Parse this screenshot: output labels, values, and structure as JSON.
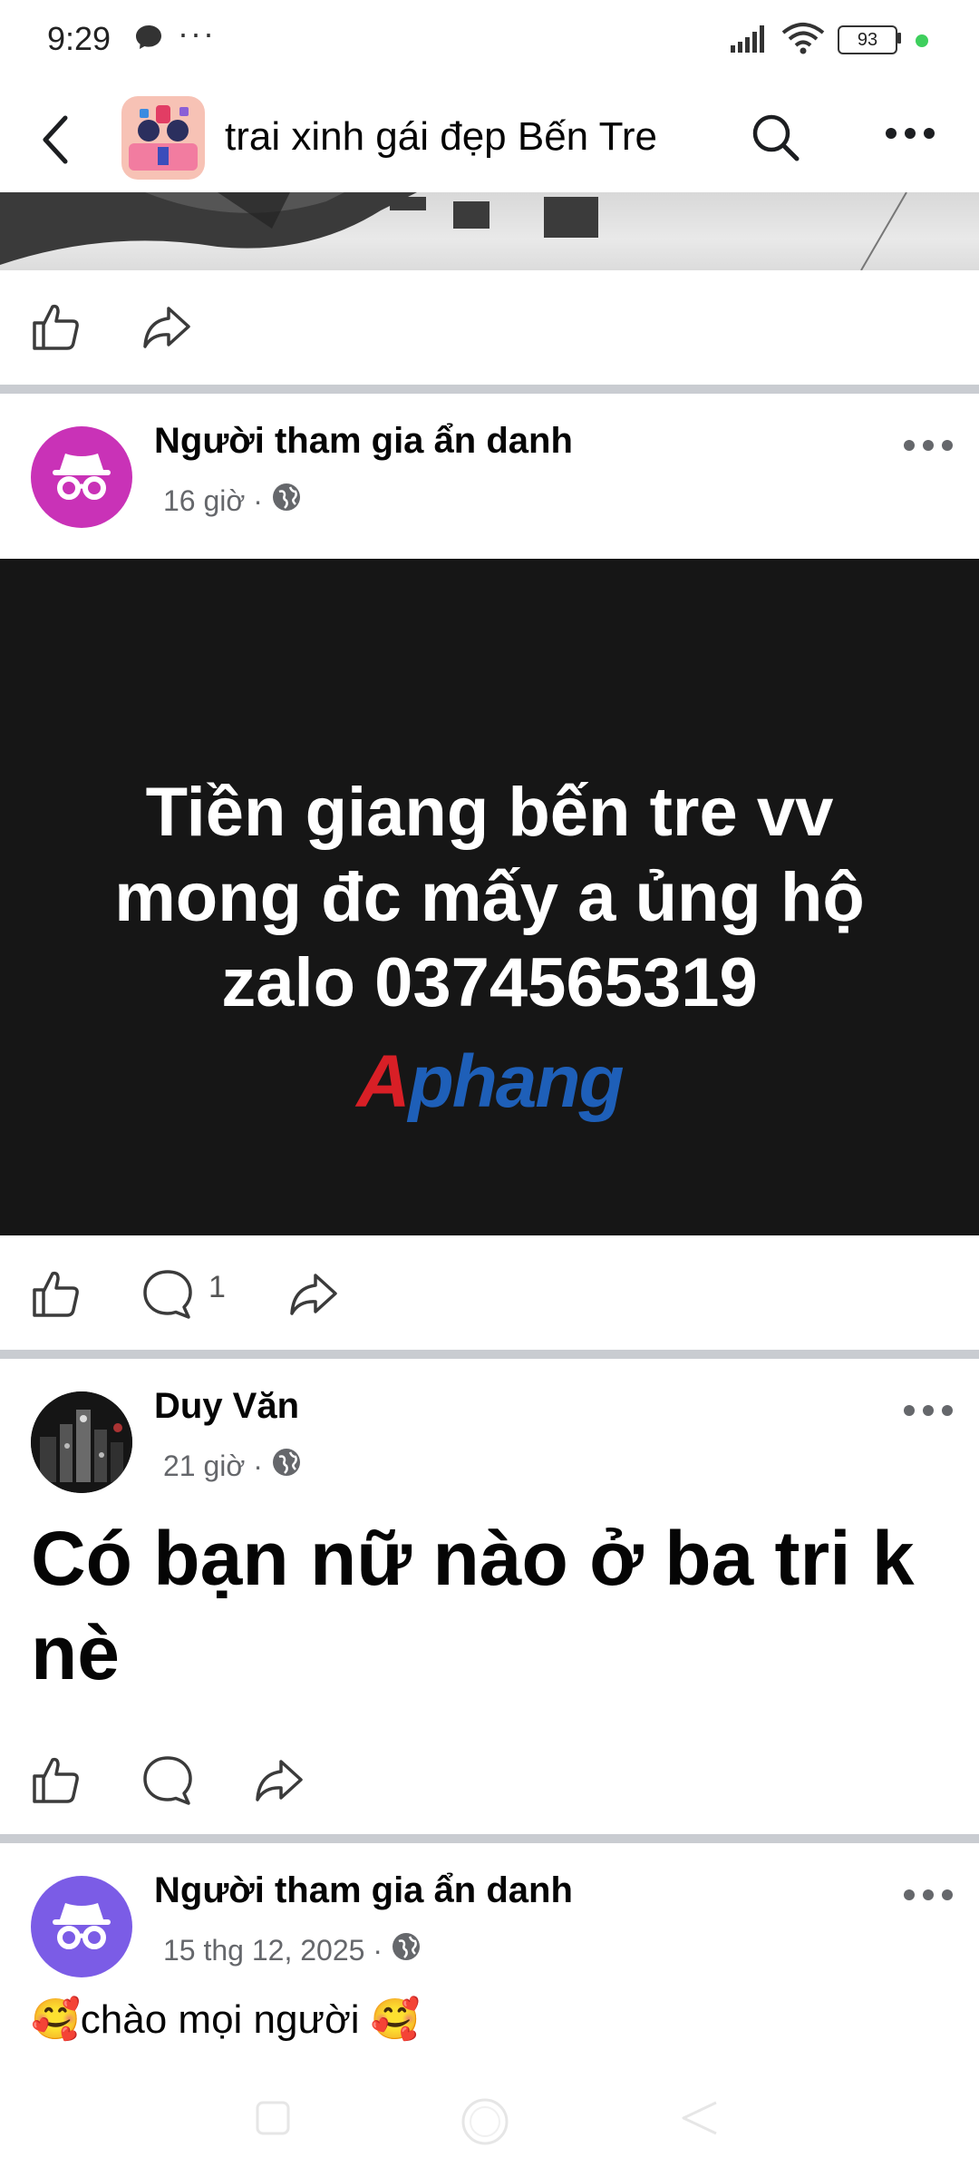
{
  "status_bar": {
    "time": "9:29",
    "dots": "···",
    "battery": "93"
  },
  "header": {
    "group_name": "trai xinh gái đẹp Bến Tre"
  },
  "posts": [
    {
      "author": "Người tham gia ẩn danh",
      "time": "16 giờ ·",
      "image_text": [
        "Tiền giang bến tre vv",
        "mong đc mấy a ủng hộ",
        "zalo 0374565319"
      ],
      "brand": "Aphang",
      "comment_count": "1"
    },
    {
      "author": "Duy Văn",
      "time": "21 giờ ·",
      "text_lines": [
        "Có bạn nữ nào ở ba tri k",
        "nè"
      ]
    },
    {
      "author": "Người tham gia ẩn danh",
      "time": "15 thg 12, 2025 ·",
      "text": "🥰chào mọi người 🥰"
    }
  ],
  "colors": {
    "anon_avatar_1": "#c932b7",
    "anon_avatar_2": "#7b5ce6",
    "separator": "#c9ccd1",
    "meta_gray": "#65676b"
  }
}
